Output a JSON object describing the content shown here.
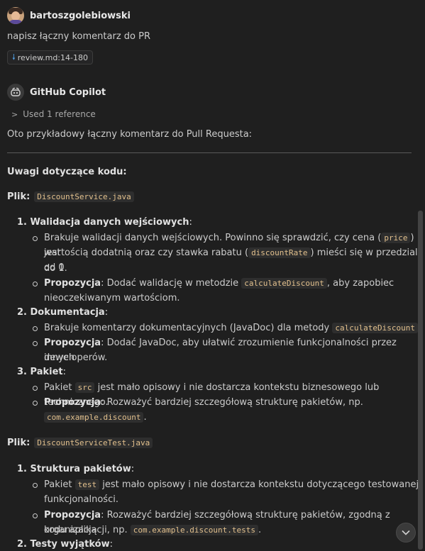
{
  "user_message": {
    "author": "bartoszgolebiowski",
    "text": "napisz łączny komentarz do PR",
    "reference_chip": "review.md:14-180"
  },
  "assistant_message": {
    "author": "GitHub Copilot",
    "used_references": "Used 1 reference",
    "intro": "Oto przykładowy łączny komentarz do Pull Requesta:",
    "heading": "Uwagi dotyczące kodu:",
    "file_label": "Plik:",
    "file1": {
      "name": "DiscountService.java",
      "items": [
        {
          "num": "1.",
          "title": "Walidacja danych wejściowych",
          "b1": {
            "t1": "Brakuje walidacji danych wejściowych. Powinno się sprawdzić, czy cena (",
            "c1": "price",
            "t2": ") jest",
            "t3": "wartością dodatnią oraz czy stawka rabatu (",
            "c2": "discountRate",
            "t4": ") mieści się w przedziale od 0",
            "t5": "do 1."
          },
          "b2": {
            "label": "Propozycja",
            "t1": ": Dodać walidację w metodzie ",
            "c1": "calculateDiscount",
            "t2": ", aby zapobiec",
            "t3": "nieoczekiwanym wartościom."
          }
        },
        {
          "num": "2.",
          "title": "Dokumentacja",
          "b1": {
            "t1": "Brakuje komentarzy dokumentacyjnych (JavaDoc) dla metody ",
            "c1": "calculateDiscount",
            "t2": "."
          },
          "b2": {
            "label": "Propozycja",
            "t1": ": Dodać JavaDoc, aby ułatwić zrozumienie funkcjonalności przez innych",
            "t2": "deweloperów."
          }
        },
        {
          "num": "3.",
          "title": "Pakiet",
          "b1": {
            "t1": "Pakiet ",
            "c1": "src",
            "t2": " jest mało opisowy i nie dostarcza kontekstu biznesowego lub technicznego."
          },
          "b2": {
            "label": "Propozycja",
            "t1": ": Rozważyć bardziej szczegółową strukturę pakietów, np.",
            "c1": "com.example.discount",
            "t2": "."
          }
        }
      ]
    },
    "file2": {
      "name": "DiscountServiceTest.java",
      "items": [
        {
          "num": "1.",
          "title": "Struktura pakietów",
          "b1": {
            "t1": "Pakiet ",
            "c1": "test",
            "t2": " jest mało opisowy i nie dostarcza kontekstu dotyczącego testowanej",
            "t3": "funkcjonalności."
          },
          "b2": {
            "label": "Propozycja",
            "t1": ": Rozważyć bardziej szczegółową strukturę pakietów, zgodną z organizacją",
            "t2": "kodu aplikacji, np. ",
            "c1": "com.example.discount.tests",
            "t3": "."
          }
        },
        {
          "num": "2.",
          "title": "Testy wyjątków"
        }
      ]
    }
  },
  "icons": {
    "user_avatar": "user-avatar",
    "copilot": "copilot-icon",
    "download": "download-icon",
    "chevron_right": "chevron-right-icon",
    "scroll_down": "chevron-down-icon"
  },
  "colors": {
    "background": "#1f1f1f",
    "text": "#cccccc",
    "inline_code": "#e2c08d",
    "link_icon": "#4f9ee3"
  }
}
